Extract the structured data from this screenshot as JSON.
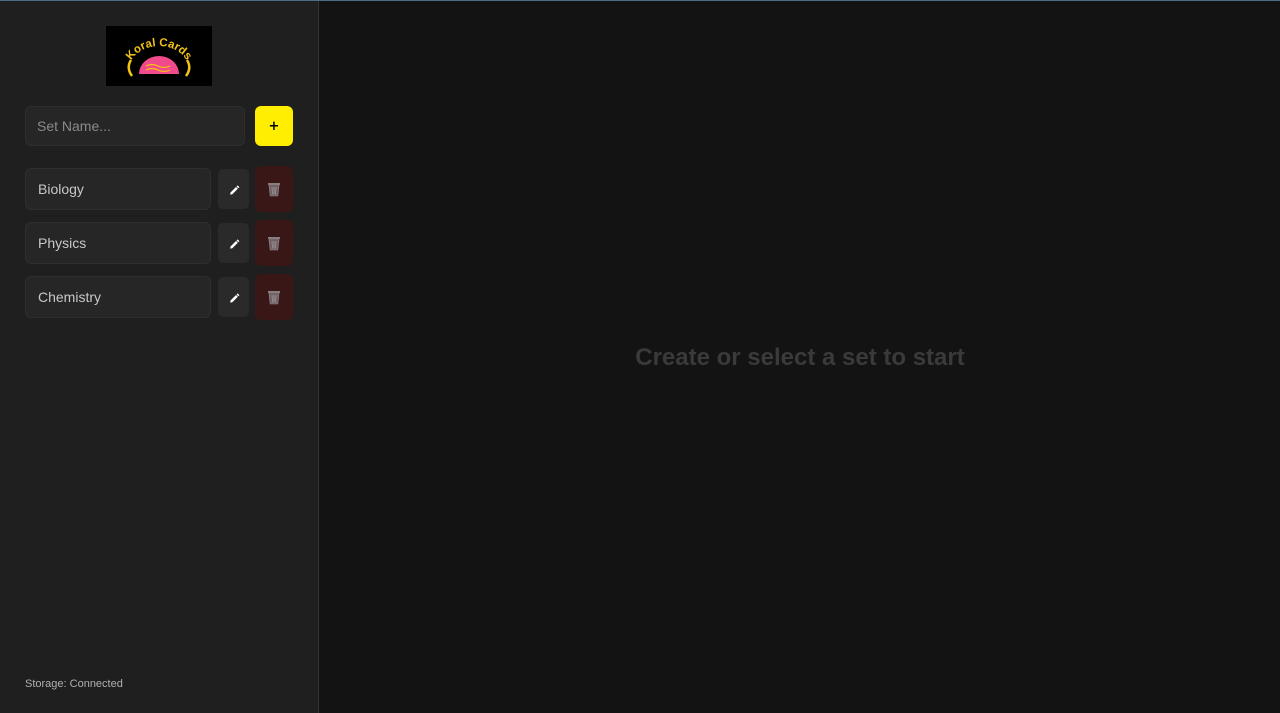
{
  "brand": {
    "logo_text": "Koral Cards",
    "icon": "koral-cards-logo"
  },
  "new_set": {
    "placeholder": "Set Name...",
    "add_label": "+"
  },
  "sets": [
    {
      "name": "Biology",
      "edit_icon": "pencil-icon",
      "delete_icon": "trash-icon"
    },
    {
      "name": "Physics",
      "edit_icon": "pencil-icon",
      "delete_icon": "trash-icon"
    },
    {
      "name": "Chemistry",
      "edit_icon": "pencil-icon",
      "delete_icon": "trash-icon"
    }
  ],
  "status": "Storage: Connected",
  "main": {
    "empty_message": "Create or select a set to start"
  },
  "colors": {
    "accent": "#ffee00",
    "sidebar_bg": "#1f1f1f",
    "main_bg": "#131313",
    "delete_bg": "#3a1717",
    "logo_pink": "#f04a8c",
    "logo_gold": "#f3c316"
  }
}
